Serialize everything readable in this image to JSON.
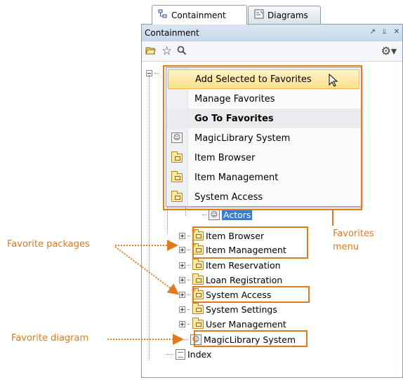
{
  "tabs": [
    {
      "label": "Containment",
      "icon": "containment-tree-icon",
      "active": true
    },
    {
      "label": "Diagrams",
      "icon": "diagrams-icon",
      "active": false
    }
  ],
  "panel": {
    "title": "Containment"
  },
  "menu": {
    "items": [
      {
        "label": "Add Selected to Favorites",
        "icon": "",
        "bold": false
      },
      {
        "label": "Manage Favorites",
        "icon": "",
        "bold": false
      },
      {
        "label": "Go To Favorites",
        "icon": "",
        "bold": true
      },
      {
        "label": "MagicLibrary System",
        "icon": "use-case-diagram-icon",
        "bold": false
      },
      {
        "label": "Item Browser",
        "icon": "package-icon",
        "bold": false
      },
      {
        "label": "Item Management",
        "icon": "package-icon",
        "bold": false
      },
      {
        "label": "System Access",
        "icon": "package-icon",
        "bold": false
      }
    ]
  },
  "tree": {
    "items": [
      {
        "label": "Actors",
        "icon": "use-case-diagram-icon",
        "selected": true
      },
      {
        "label": "Item Browser",
        "icon": "package-icon",
        "favorite": true
      },
      {
        "label": "Item Management",
        "icon": "package-icon",
        "favorite": true
      },
      {
        "label": "Item Reservation",
        "icon": "package-icon"
      },
      {
        "label": "Loan Registration",
        "icon": "package-icon"
      },
      {
        "label": "System Access",
        "icon": "package-icon",
        "favorite": true
      },
      {
        "label": "System Settings",
        "icon": "package-icon"
      },
      {
        "label": "User Management",
        "icon": "package-icon"
      },
      {
        "label": "MagicLibrary System",
        "icon": "use-case-diagram-icon",
        "favorite": true
      },
      {
        "label": "Index",
        "icon": "document-icon"
      }
    ]
  },
  "callouts": {
    "favorite_packages": "Favorite packages",
    "favorite_diagram": "Favorite diagram",
    "favorites_menu_line1": "Favorites",
    "favorites_menu_line2": "menu"
  },
  "colors": {
    "callout": "#e07a1f",
    "selection": "#3a7bd5",
    "menu_hover": "#ffe08a"
  }
}
